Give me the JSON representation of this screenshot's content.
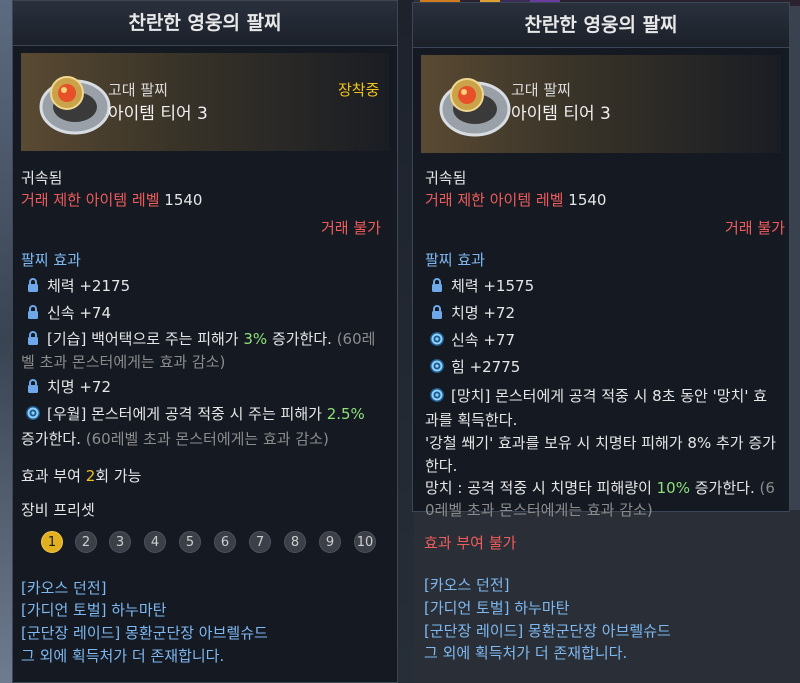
{
  "left": {
    "title": "찬란한 영웅의 팔찌",
    "grade": "고대 팔찌",
    "tier": "아이템 티어 3",
    "equipped": "장착중",
    "bound": "귀속됨",
    "trade_level_label": "거래 제한 아이템 레벨",
    "trade_level_value": "1540",
    "trade_status": "거래 불가",
    "effects_header": "팔찌 효과",
    "effects": {
      "e1": "체력 +2175",
      "e2": "신속 +74",
      "e3a": "[기습] 백어택으로 주는 피해가 ",
      "e3b": "3%",
      "e3c": " 증가한다. ",
      "e3d": "(60레",
      "e3e": "벨 초과 몬스터에게는 효과 감소)",
      "e4": "치명 +72",
      "e5a": "[우월] 몬스터에게 공격 적중 시 주는 피해가 ",
      "e5b": "2.5%",
      "e5c": "증가한다. ",
      "e5d": "(60레벨 초과 몬스터에게는 효과 감소)"
    },
    "grant_a": "효과 부여 ",
    "grant_b": "2",
    "grant_c": "회 가능",
    "preset_header": "장비 프리셋",
    "presets": [
      "1",
      "2",
      "3",
      "4",
      "5",
      "6",
      "7",
      "8",
      "9",
      "10"
    ],
    "sources": [
      "[카오스 던전]",
      "[가디언 토벌] 하누마탄",
      "[군단장 레이드] 몽환군단장 아브렐슈드",
      "그 외에 획득처가 더 존재합니다."
    ]
  },
  "right": {
    "title": "찬란한 영웅의 팔찌",
    "grade": "고대 팔찌",
    "tier": "아이템 티어 3",
    "bound": "귀속됨",
    "trade_level_label": "거래 제한 아이템 레벨",
    "trade_level_value": "1540",
    "trade_status": "거래 불가",
    "effects_header": "팔찌 효과",
    "effects": {
      "e1": "체력 +1575",
      "e2": "치명 +72",
      "e3": "신속 +77",
      "e4": "힘 +2775",
      "e5a": "[망치] 몬스터에게 공격 적중 시 8초 동안 '망치' 효",
      "e5b": "과를 획득한다.",
      "e5c": "'강철 쐐기' 효과를 보유 시 치명타 피해가 8% 추가 증가",
      "e5d": "한다.",
      "e5e": "망치 : 공격 적중 시 치명타 피해량이 ",
      "e5f": "10%",
      "e5g": " 증가한다. ",
      "e5h": "(6",
      "e5i": "0레벨 초과 몬스터에게는 효과 감소)"
    },
    "grant": "효과 부여 불가",
    "sources": [
      "[카오스 던전]",
      "[가디언 토벌] 하누마탄",
      "[군단장 레이드] 몽환군단장 아브렐슈드",
      "그 외에 획득처가 더 존재합니다."
    ]
  }
}
